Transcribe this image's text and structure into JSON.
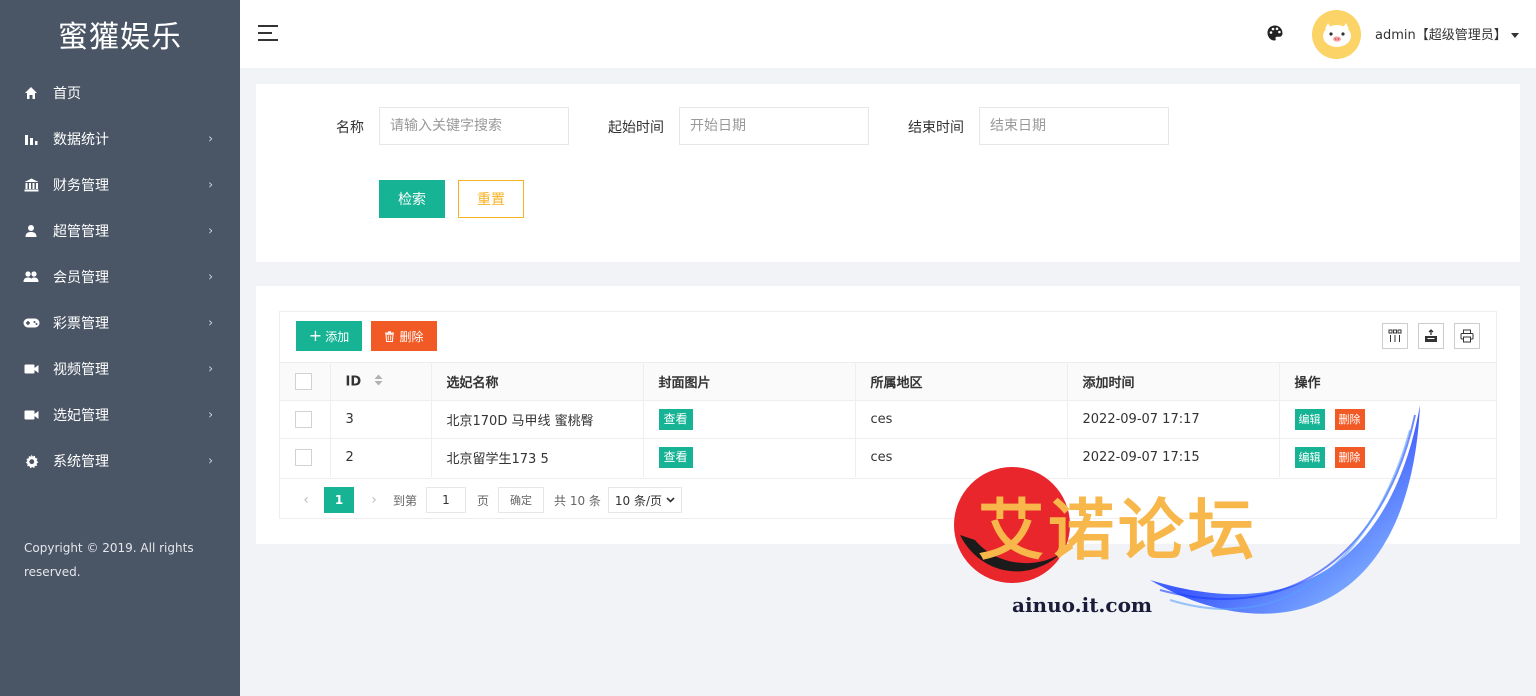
{
  "app": {
    "brand": "蜜獾娱乐"
  },
  "sidebar": {
    "items": [
      {
        "label": "首页",
        "icon": "home-icon",
        "has_children": false
      },
      {
        "label": "数据统计",
        "icon": "bar-chart-icon",
        "has_children": true
      },
      {
        "label": "财务管理",
        "icon": "bank-icon",
        "has_children": true
      },
      {
        "label": "超管管理",
        "icon": "user-icon",
        "has_children": true
      },
      {
        "label": "会员管理",
        "icon": "users-icon",
        "has_children": true
      },
      {
        "label": "彩票管理",
        "icon": "gamepad-icon",
        "has_children": true
      },
      {
        "label": "视频管理",
        "icon": "video-icon",
        "has_children": true
      },
      {
        "label": "选妃管理",
        "icon": "video-icon",
        "has_children": true
      },
      {
        "label": "系统管理",
        "icon": "gear-icon",
        "has_children": true
      }
    ],
    "chevron": "›",
    "copyright": "Copyright © 2019. All rights reserved."
  },
  "header": {
    "user_label": "admin【超级管理员】",
    "avatar_color": "#fbd366"
  },
  "search": {
    "name_label": "名称",
    "name_placeholder": "请输入关键字搜索",
    "start_label": "起始时间",
    "start_placeholder": "开始日期",
    "end_label": "结束时间",
    "end_placeholder": "结束日期",
    "search_button": "检索",
    "reset_button": "重置"
  },
  "table": {
    "add_button": "添加",
    "delete_button": "删除",
    "columns": [
      "ID",
      "选妃名称",
      "封面图片",
      "所属地区",
      "添加时间",
      "操作"
    ],
    "rows": [
      {
        "id": "3",
        "name": "北京170D 马甲线 蜜桃臀",
        "cover": "查看",
        "region": "ces",
        "time": "2022-09-07 17:17",
        "edit": "编辑",
        "remove": "删除"
      },
      {
        "id": "2",
        "name": "北京留学生173 5",
        "cover": "查看",
        "region": "ces",
        "time": "2022-09-07 17:15",
        "edit": "编辑",
        "remove": "删除"
      }
    ]
  },
  "pagination": {
    "prev": "‹",
    "current_page": "1",
    "next": "›",
    "goto_label": "到第",
    "goto_value": "1",
    "page_unit": "页",
    "confirm": "确定",
    "total": "共 10 条",
    "page_size": "10 条/页"
  },
  "watermark": {
    "text": "艾诺论坛",
    "url": "ainuo.it.com"
  },
  "colors": {
    "sidebar": "#4a5565",
    "primary": "#16b394",
    "danger": "#f15a24",
    "warning": "#f5b225"
  }
}
